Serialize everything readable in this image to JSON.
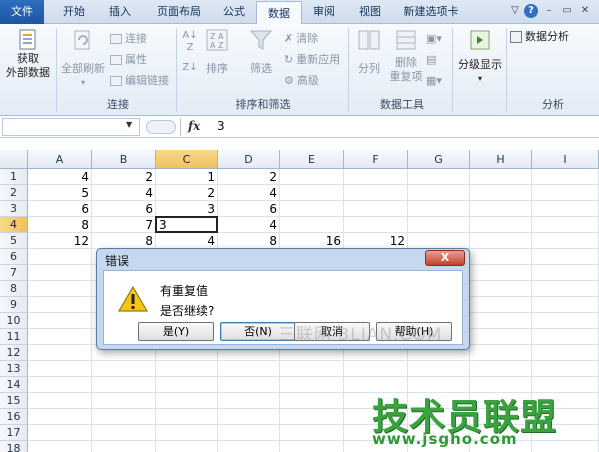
{
  "tabs": [
    "文件",
    "开始",
    "插入",
    "页面布局",
    "公式",
    "数据",
    "审阅",
    "视图",
    "新建选项卡"
  ],
  "active_tab": "数据",
  "ribbon": {
    "get_external": [
      "获取",
      "外部数据"
    ],
    "refresh_all": "全部刷新",
    "connections": "连接",
    "properties": "属性",
    "edit_links": "编辑链接",
    "sort": "排序",
    "filter": "筛选",
    "clear": "清除",
    "reapply": "重新应用",
    "advanced": "高级",
    "text_to_columns": "分列",
    "remove_dup": "删除",
    "remove_dup2": "重复项",
    "outline": "分级显示",
    "data_analysis": "数据分析",
    "group_connections": "连接",
    "group_sortfilter": "排序和筛选",
    "group_datatools": "数据工具",
    "group_analysis": "分析"
  },
  "formula_bar": {
    "namebox": "",
    "fx": "fx",
    "value": "3"
  },
  "columns": [
    "A",
    "B",
    "C",
    "D",
    "E",
    "F",
    "G",
    "H",
    "I"
  ],
  "rows": [
    "1",
    "2",
    "3",
    "4",
    "5",
    "6",
    "7",
    "8",
    "9",
    "10",
    "11",
    "12",
    "13",
    "14",
    "15",
    "16",
    "17",
    "18"
  ],
  "cells": {
    "r1": [
      "4",
      "2",
      "1",
      "2"
    ],
    "r2": [
      "5",
      "4",
      "2",
      "4"
    ],
    "r3": [
      "6",
      "6",
      "3",
      "6"
    ],
    "r4": [
      "8",
      "7",
      "",
      "4"
    ],
    "r5": [
      "12",
      "8",
      "4",
      "8",
      "16",
      "12"
    ]
  },
  "active_cell_value": "3",
  "dialog": {
    "title": "错误",
    "close": "X",
    "message1": "有重复值",
    "message2": "是否继续?",
    "yes": "是(Y)",
    "no": "否(N)",
    "cancel": "取消",
    "help": "帮助(H)"
  },
  "watermarks": {
    "dialog_text": "三联网 3LIAN.COM",
    "brand": "技术员联盟",
    "url": "www.jsgho.com"
  },
  "colors": {
    "file_tab": "#1d55a2",
    "selected_header": "#f1c15f",
    "brand_green": "#3aa23e"
  }
}
